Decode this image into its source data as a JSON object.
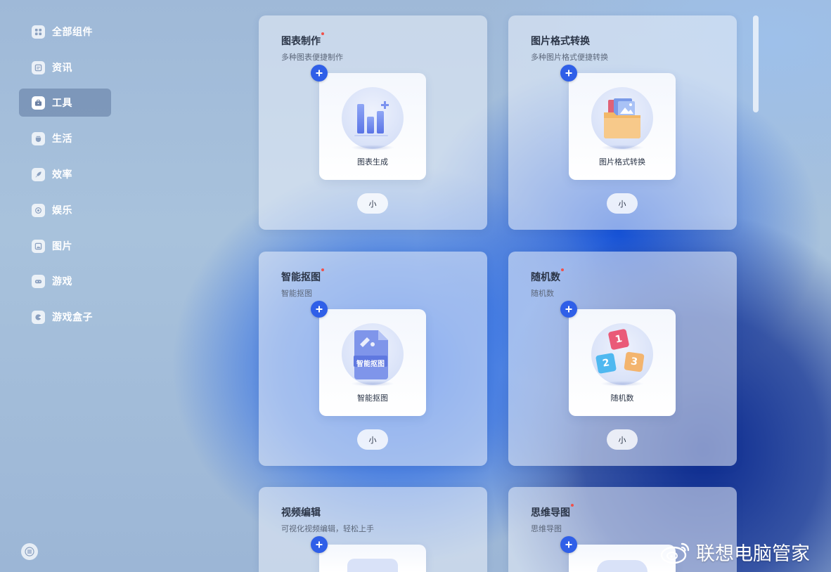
{
  "sidebar": {
    "items": [
      {
        "label": "全部组件",
        "icon": "widgets-icon"
      },
      {
        "label": "资讯",
        "icon": "news-icon"
      },
      {
        "label": "工具",
        "icon": "toolbox-icon",
        "active": true
      },
      {
        "label": "生活",
        "icon": "life-icon"
      },
      {
        "label": "效率",
        "icon": "rocket-icon"
      },
      {
        "label": "娱乐",
        "icon": "entertainment-icon"
      },
      {
        "label": "图片",
        "icon": "image-icon"
      },
      {
        "label": "游戏",
        "icon": "gamepad-icon"
      },
      {
        "label": "游戏盒子",
        "icon": "game-box-icon"
      }
    ],
    "menu_icon": "menu-icon"
  },
  "cards": [
    {
      "title": "图表制作",
      "subtitle": "多种图表便捷制作",
      "widget_label": "图表生成",
      "size_label": "小",
      "new_dot": true
    },
    {
      "title": "图片格式转换",
      "subtitle": "多种图片格式便捷转换",
      "widget_label": "图片格式转换",
      "size_label": "小",
      "new_dot": false
    },
    {
      "title": "智能抠图",
      "subtitle": "智能抠图",
      "widget_label": "智能抠图",
      "icon_text": "智能抠图",
      "size_label": "小",
      "new_dot": true
    },
    {
      "title": "随机数",
      "subtitle": "随机数",
      "widget_label": "随机数",
      "dice": [
        "1",
        "2",
        "3"
      ],
      "size_label": "小",
      "new_dot": true
    },
    {
      "title": "视频编辑",
      "subtitle": "可视化视频编辑，轻松上手",
      "new_dot": false
    },
    {
      "title": "思维导图",
      "subtitle": "思维导图",
      "new_dot": true
    }
  ],
  "watermark": {
    "text": "联想电脑管家"
  },
  "colors": {
    "accent": "#2f5fe8",
    "new_dot": "#f0504a"
  }
}
